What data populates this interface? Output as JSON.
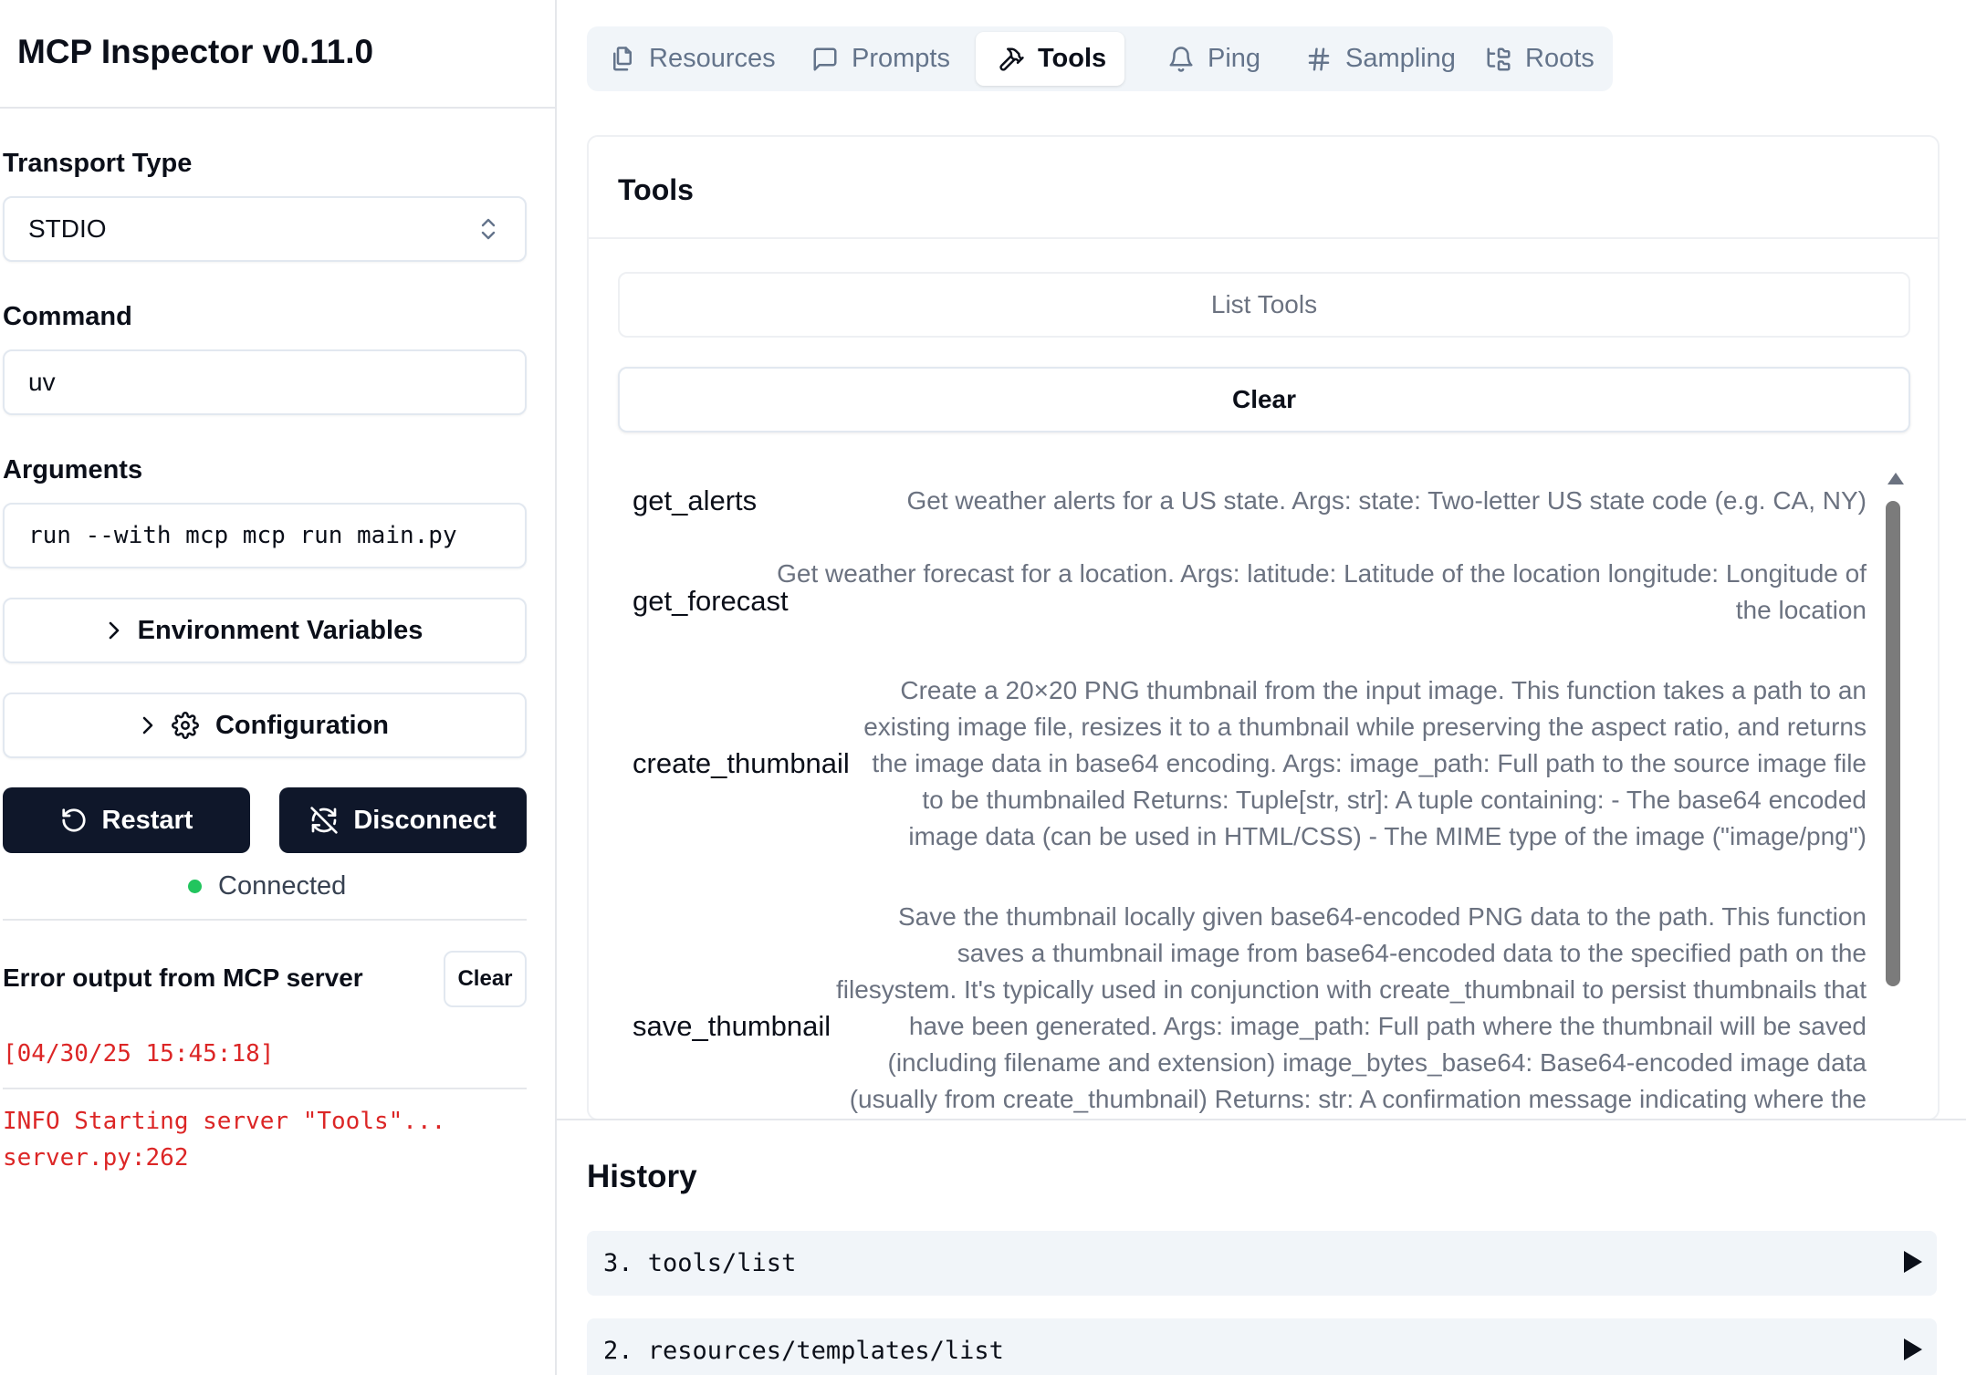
{
  "app": {
    "title": "MCP Inspector v0.11.0"
  },
  "sidebar": {
    "transport_label": "Transport Type",
    "transport_value": "STDIO",
    "command_label": "Command",
    "command_value": "uv",
    "arguments_label": "Arguments",
    "arguments_value": "run --with mcp mcp run main.py",
    "env_vars_label": "Environment Variables",
    "configuration_label": "Configuration",
    "restart_label": "Restart",
    "disconnect_label": "Disconnect",
    "status_text": "Connected",
    "status_color": "#22c55e",
    "error_title": "Error output from MCP server",
    "error_clear_label": "Clear",
    "log_lines": [
      "[04/30/25 15:45:18]",
      "INFO Starting server \"Tools\"...",
      "server.py:262"
    ]
  },
  "tabs": [
    {
      "label": "Resources",
      "icon": "files-icon"
    },
    {
      "label": "Prompts",
      "icon": "message-square-icon"
    },
    {
      "label": "Tools",
      "icon": "hammer-icon",
      "active": true
    },
    {
      "label": "Ping",
      "icon": "bell-icon"
    },
    {
      "label": "Sampling",
      "icon": "hash-icon"
    },
    {
      "label": "Roots",
      "icon": "folder-tree-icon"
    }
  ],
  "tools_panel": {
    "title": "Tools",
    "list_button": "List Tools",
    "clear_button": "Clear",
    "tools": [
      {
        "name": "get_alerts",
        "description": "Get weather alerts for a US state. Args: state: Two-letter US state code (e.g. CA, NY)"
      },
      {
        "name": "get_forecast",
        "description": "Get weather forecast for a location. Args: latitude: Latitude of the location longitude: Longitude of the location"
      },
      {
        "name": "create_thumbnail",
        "description": "Create a 20×20 PNG thumbnail from the input image. This function takes a path to an existing image file, resizes it to a thumbnail while preserving the aspect ratio, and returns the image data in base64 encoding. Args: image_path: Full path to the source image file to be thumbnailed Returns: Tuple[str, str]: A tuple containing: - The base64 encoded image data (can be used in HTML/CSS) - The MIME type of the image (\"image/png\")"
      },
      {
        "name": "save_thumbnail",
        "description": "Save the thumbnail locally given base64-encoded PNG data to the path. This function saves a thumbnail image from base64-encoded data to the specified path on the filesystem. It's typically used in conjunction with create_thumbnail to persist thumbnails that have been generated. Args: image_path: Full path where the thumbnail will be saved (including filename and extension) image_bytes_base64: Base64-encoded image data (usually from create_thumbnail) Returns: str: A confirmation message indicating where the thumbnail was"
      }
    ]
  },
  "history": {
    "title": "History",
    "items": [
      {
        "label": "3. tools/list"
      },
      {
        "label": "2. resources/templates/list"
      }
    ]
  }
}
